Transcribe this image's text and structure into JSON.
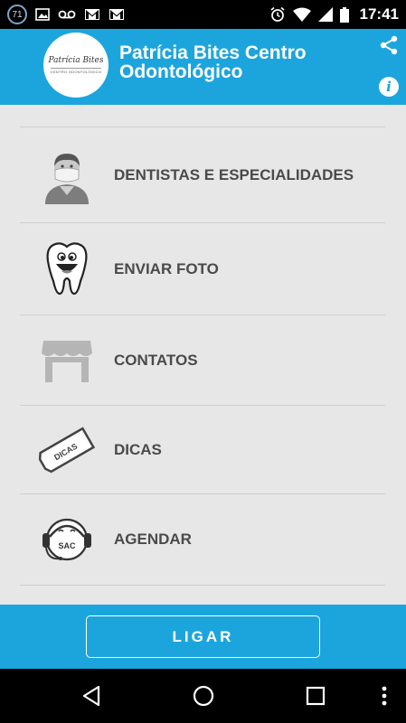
{
  "status_bar": {
    "notification_count": "71",
    "time": "17:41",
    "icons": [
      "notification-badge",
      "image-icon",
      "voicemail-icon",
      "gmail-icon",
      "gmail-icon",
      "alarm-icon",
      "wifi-icon",
      "signal-icon",
      "battery-icon"
    ]
  },
  "header": {
    "logo_script": "Patrícia Bites",
    "logo_subtext": "CENTRO ODONTOLÓGICO",
    "title": "Patrícia Bites Centro Odontológico",
    "accent_color": "#1ca5dd"
  },
  "menu": {
    "items": [
      {
        "label": "DENTISTAS E ESPECIALIDADES",
        "icon": "dentist-icon"
      },
      {
        "label": "ENVIAR FOTO",
        "icon": "tooth-icon"
      },
      {
        "label": "CONTATOS",
        "icon": "store-icon"
      },
      {
        "label": "DICAS",
        "icon": "tips-tag-icon",
        "icon_text": "DICAS"
      },
      {
        "label": "AGENDAR",
        "icon": "support-headset-icon",
        "icon_text": "SAC"
      }
    ]
  },
  "footer": {
    "call_button": "LIGAR"
  },
  "nav_bar": {
    "buttons": [
      "back-icon",
      "home-icon",
      "recents-icon",
      "more-icon"
    ]
  }
}
